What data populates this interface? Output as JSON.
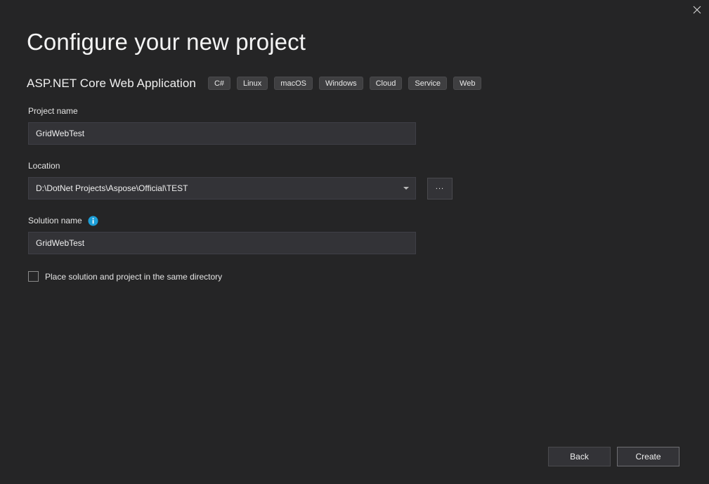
{
  "window": {
    "title": "Configure your new project",
    "close_icon": "close-icon"
  },
  "template": {
    "name": "ASP.NET Core Web Application",
    "tags": [
      "C#",
      "Linux",
      "macOS",
      "Windows",
      "Cloud",
      "Service",
      "Web"
    ]
  },
  "fields": {
    "project_name": {
      "label": "Project name",
      "value": "GridWebTest",
      "placeholder": ""
    },
    "location": {
      "label": "Location",
      "value": "D:\\DotNet Projects\\Aspose\\Official\\TEST",
      "placeholder": "",
      "browse_label": "...",
      "dropdown_icon": "chevron-down-icon"
    },
    "solution_name": {
      "label": "Solution name",
      "value": "GridWebTest",
      "placeholder": "",
      "info_icon": "info-icon"
    },
    "same_directory": {
      "label": "Place solution and project in the same directory",
      "checked": false
    }
  },
  "footer": {
    "back_label": "Back",
    "create_label": "Create"
  },
  "colors": {
    "background": "#252526",
    "input_background": "#333337",
    "tag_background": "#3f3f41",
    "info_accent": "#1c9fd8",
    "text": "#f1f1f1"
  }
}
